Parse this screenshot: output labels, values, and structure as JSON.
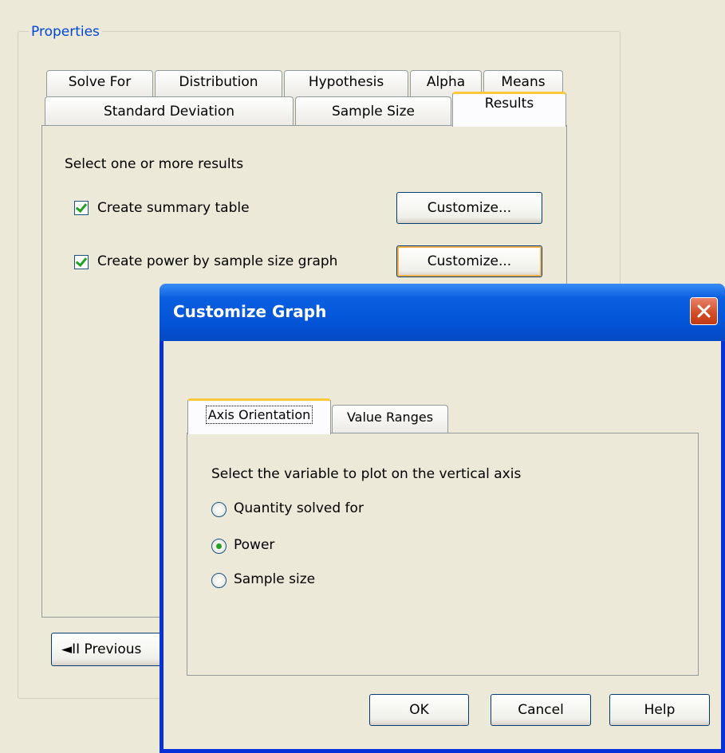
{
  "properties": {
    "legend": "Properties",
    "tabs_row1": [
      "Solve For",
      "Distribution",
      "Hypothesis",
      "Alpha",
      "Means"
    ],
    "tabs_row2": [
      "Standard Deviation",
      "Sample Size",
      "Results"
    ],
    "active_tab": "Results",
    "results": {
      "instruction": "Select one or more results",
      "summary_table": {
        "label": "Create summary table",
        "checked": true,
        "button": "Customize..."
      },
      "power_graph": {
        "label": "Create power by sample size graph",
        "checked": true,
        "button": "Customize..."
      }
    },
    "previous_button": "◄II Previous"
  },
  "dialog": {
    "title": "Customize Graph",
    "tabs": [
      "Axis Orientation",
      "Value Ranges"
    ],
    "active_tab": "Axis Orientation",
    "instruction": "Select the variable to plot on the vertical axis",
    "options": [
      {
        "label": "Quantity solved for",
        "selected": false
      },
      {
        "label": "Power",
        "selected": true
      },
      {
        "label": "Sample size",
        "selected": false
      }
    ],
    "buttons": {
      "ok": "OK",
      "cancel": "Cancel",
      "help": "Help"
    }
  },
  "colors": {
    "window_bg": "#ece9d8",
    "title_blue": "#0453d7",
    "check_green": "#21a121",
    "tab_highlight": "#ffc83c"
  }
}
